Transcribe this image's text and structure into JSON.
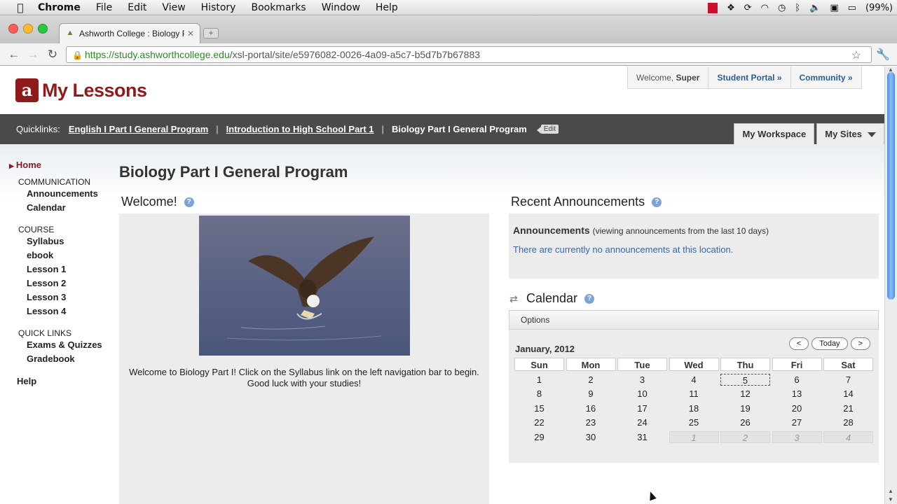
{
  "menubar": {
    "app_name": "Chrome",
    "items": [
      "File",
      "Edit",
      "View",
      "History",
      "Bookmarks",
      "Window",
      "Help"
    ],
    "battery": "(99%)"
  },
  "browser": {
    "tab_title": "Ashworth College : Biology P",
    "url_host": "https://study.ashworthcollege.edu",
    "url_path": "/xsl-portal/site/e5976082-0026-4a09-a5c7-b5d7b7b67883"
  },
  "header": {
    "logo_text": "My Lessons",
    "welcome_prefix": "Welcome, ",
    "welcome_name": "Super",
    "student_portal": "Student Portal »",
    "community": "Community »"
  },
  "quicklinks": {
    "label": "Quicklinks:",
    "links": [
      "English I Part I General Program",
      "Introduction to High School Part 1"
    ],
    "current": "Biology Part I General Program",
    "edit": "Edit",
    "my_workspace": "My Workspace",
    "my_sites": "My Sites"
  },
  "nav": {
    "home": "Home",
    "sections": [
      {
        "title": "COMMUNICATION",
        "items": [
          "Announcements",
          "Calendar"
        ]
      },
      {
        "title": "COURSE",
        "items": [
          "Syllabus",
          "ebook",
          "Lesson 1",
          "Lesson 2",
          "Lesson 3",
          "Lesson 4"
        ]
      },
      {
        "title": "QUICK LINKS",
        "items": [
          "Exams & Quizzes",
          "Gradebook"
        ]
      }
    ],
    "help": "Help"
  },
  "main": {
    "page_title": "Biology Part I General Program",
    "welcome_title": "Welcome!",
    "welcome_text": "Welcome to Biology Part I! Click on the Syllabus link on the left navigation bar to begin. Good luck with your studies!",
    "announcements_title": "Recent Announcements",
    "announcements_label": "Announcements",
    "announcements_range": "(viewing announcements from the last 10 days)",
    "announcements_empty": "There are currently no announcements at this location.",
    "calendar_title": "Calendar",
    "calendar_options": "Options",
    "calendar_month": "January, 2012",
    "calendar_prev": "<",
    "calendar_today": "Today",
    "calendar_next": ">",
    "weekdays": [
      "Sun",
      "Mon",
      "Tue",
      "Wed",
      "Thu",
      "Fri",
      "Sat"
    ],
    "weeks": [
      [
        "1",
        "2",
        "3",
        "4",
        "5",
        "6",
        "7"
      ],
      [
        "8",
        "9",
        "10",
        "11",
        "12",
        "13",
        "14"
      ],
      [
        "15",
        "16",
        "17",
        "18",
        "19",
        "20",
        "21"
      ],
      [
        "22",
        "23",
        "24",
        "25",
        "26",
        "27",
        "28"
      ],
      [
        "29",
        "30",
        "31",
        "1",
        "2",
        "3",
        "4"
      ]
    ],
    "today": "5"
  }
}
